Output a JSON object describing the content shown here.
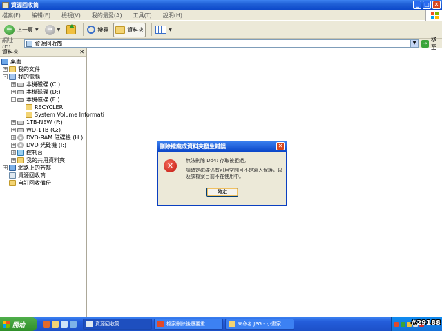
{
  "window": {
    "title": "資源回收筒"
  },
  "menu": [
    "檔案(F)",
    "編輯(E)",
    "檢視(V)",
    "我的最愛(A)",
    "工具(T)",
    "說明(H)"
  ],
  "toolbar": {
    "back_label": "上一頁",
    "search_label": "搜尋",
    "folders_label": "資料夾"
  },
  "address": {
    "label": "網址(D)",
    "value": "資源回收筒",
    "go_label": "移至"
  },
  "folders_pane": {
    "title": "資料夾",
    "items": [
      "桌面",
      "我的文件",
      "我的電腦",
      "本機磁碟 (C:)",
      "本機磁碟 (D:)",
      "本機磁碟 (E:)",
      "RECYCLER",
      "System Volume Informati",
      "1TB-NEW (F:)",
      "WD-1TB (G:)",
      "DVD-RAM 磁碟機 (H:)",
      "DVD 光碟機 (I:)",
      "控制台",
      "我的共用資料夾",
      "網路上的芳鄰",
      "資源回收筒",
      "自訂回收備份"
    ]
  },
  "dialog": {
    "title": "刪除檔案或資料夾發生錯誤",
    "message1": "無法刪除 Dd4: 存取被拒絕。",
    "message2": "請確定磁碟仍有可用空間且不是寫入保護，以及該檔案目前不在使用中。",
    "ok_label": "確定"
  },
  "taskbar": {
    "start_label": "開始",
    "tasks": [
      "資源回收筒",
      "檔案刪除後還要重...",
      "未命名.JPG - 小畫家"
    ]
  },
  "watermark": "#29188"
}
